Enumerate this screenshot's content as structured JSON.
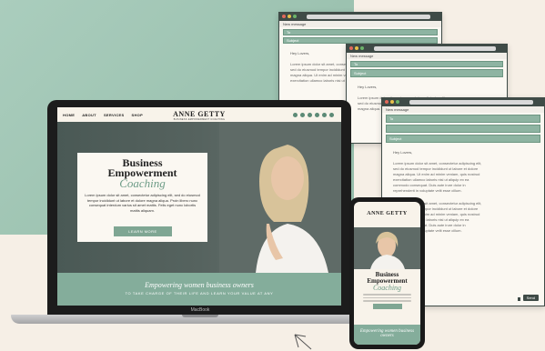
{
  "email_window": {
    "title": "New message",
    "to_label": "To",
    "subject_label": "Subject",
    "greeting": "Hey Lovers,",
    "body_lines": [
      "Lorem ipsum dolor sit amet, consectetur adipiscing elit,",
      "sed do eiusmod tempor incididunt ut labore et dolore",
      "magna aliqua. Ut enim ad minim veniam, quis nostrud",
      "exercitation ullamco laboris nisi ut aliquip ex ea",
      "commodo consequat. Duis aute irure dolor in",
      "reprehenderit in voluptate velit esse cillum."
    ],
    "send_label": "Send"
  },
  "website": {
    "nav": [
      "HOME",
      "ABOUT",
      "SERVICES",
      "SHOP"
    ],
    "brand_name": "ANNE GETTY",
    "brand_tagline": "BUSINESS EMPOWERMENT COACHING",
    "hero_title_line1": "Business",
    "hero_title_line2": "Empowerment",
    "hero_script": "Coaching",
    "hero_text": "Lorem ipsum dolor sit amet, consectetur adipiscing elit, sed do eiusmod tempor incididunt ut labore et dolore magna aliqua. Proin libero nunc consequat interdum varius sit amet mattis. Felis eget nunc lobortis mattis aliquam.",
    "hero_button": "LEARN MORE",
    "banner_script": "Empowering women business owners",
    "banner_sub": "TO TAKE CHARGE OF THEIR LIFE AND LEARN YOUR VALUE AT ANY"
  },
  "device_label": "MacBook",
  "colors": {
    "sage": "#84ad9b",
    "dark_slate": "#4a5955",
    "cream": "#f8f3ea"
  }
}
